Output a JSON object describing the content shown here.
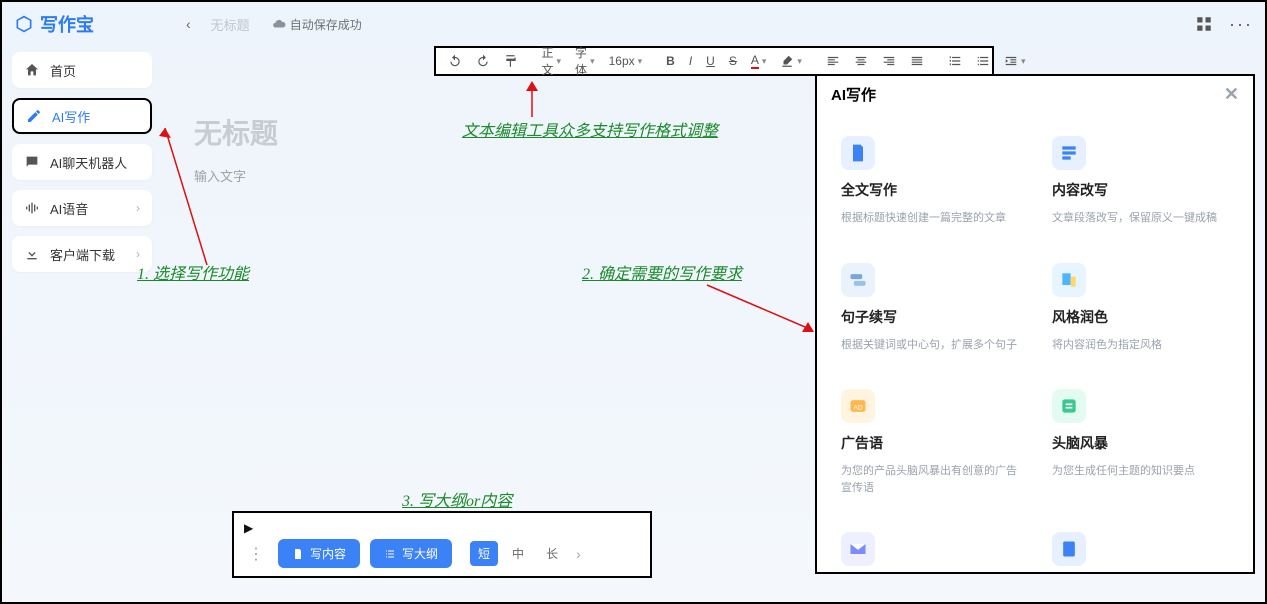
{
  "app": {
    "name": "写作宝"
  },
  "topbar": {
    "doc_title": "无标题",
    "autosave": "自动保存成功"
  },
  "sidebar": {
    "items": [
      {
        "label": "首页"
      },
      {
        "label": "AI写作"
      },
      {
        "label": "AI聊天机器人"
      },
      {
        "label": "AI语音"
      },
      {
        "label": "客户端下载"
      }
    ]
  },
  "toolbar": {
    "font_style": "正文",
    "font_family": "字体",
    "font_size": "16px"
  },
  "editor": {
    "title_placeholder": "无标题",
    "body_placeholder": "输入文字"
  },
  "bottom": {
    "write_content": "写内容",
    "write_outline": "写大纲",
    "len": {
      "short": "短",
      "mid": "中",
      "long": "长"
    }
  },
  "ai_panel": {
    "title": "AI写作",
    "cards": [
      {
        "title": "全文写作",
        "desc": "根据标题快速创建一篇完整的文章"
      },
      {
        "title": "内容改写",
        "desc": "文章段落改写，保留原义一键成稿"
      },
      {
        "title": "句子续写",
        "desc": "根据关键词或中心句，扩展多个句子"
      },
      {
        "title": "风格润色",
        "desc": "将内容润色为指定风格"
      },
      {
        "title": "广告语",
        "desc": "为您的产品头脑风暴出有创意的广告宣传语"
      },
      {
        "title": "头脑风暴",
        "desc": "为您生成任何主题的知识要点"
      }
    ]
  },
  "annotations": {
    "a1": "1. 选择写作功能",
    "a2": "文本编辑工具众多支持写作格式调整",
    "a3": "2. 确定需要的写作要求",
    "a4": "3. 写大纲or内容"
  }
}
